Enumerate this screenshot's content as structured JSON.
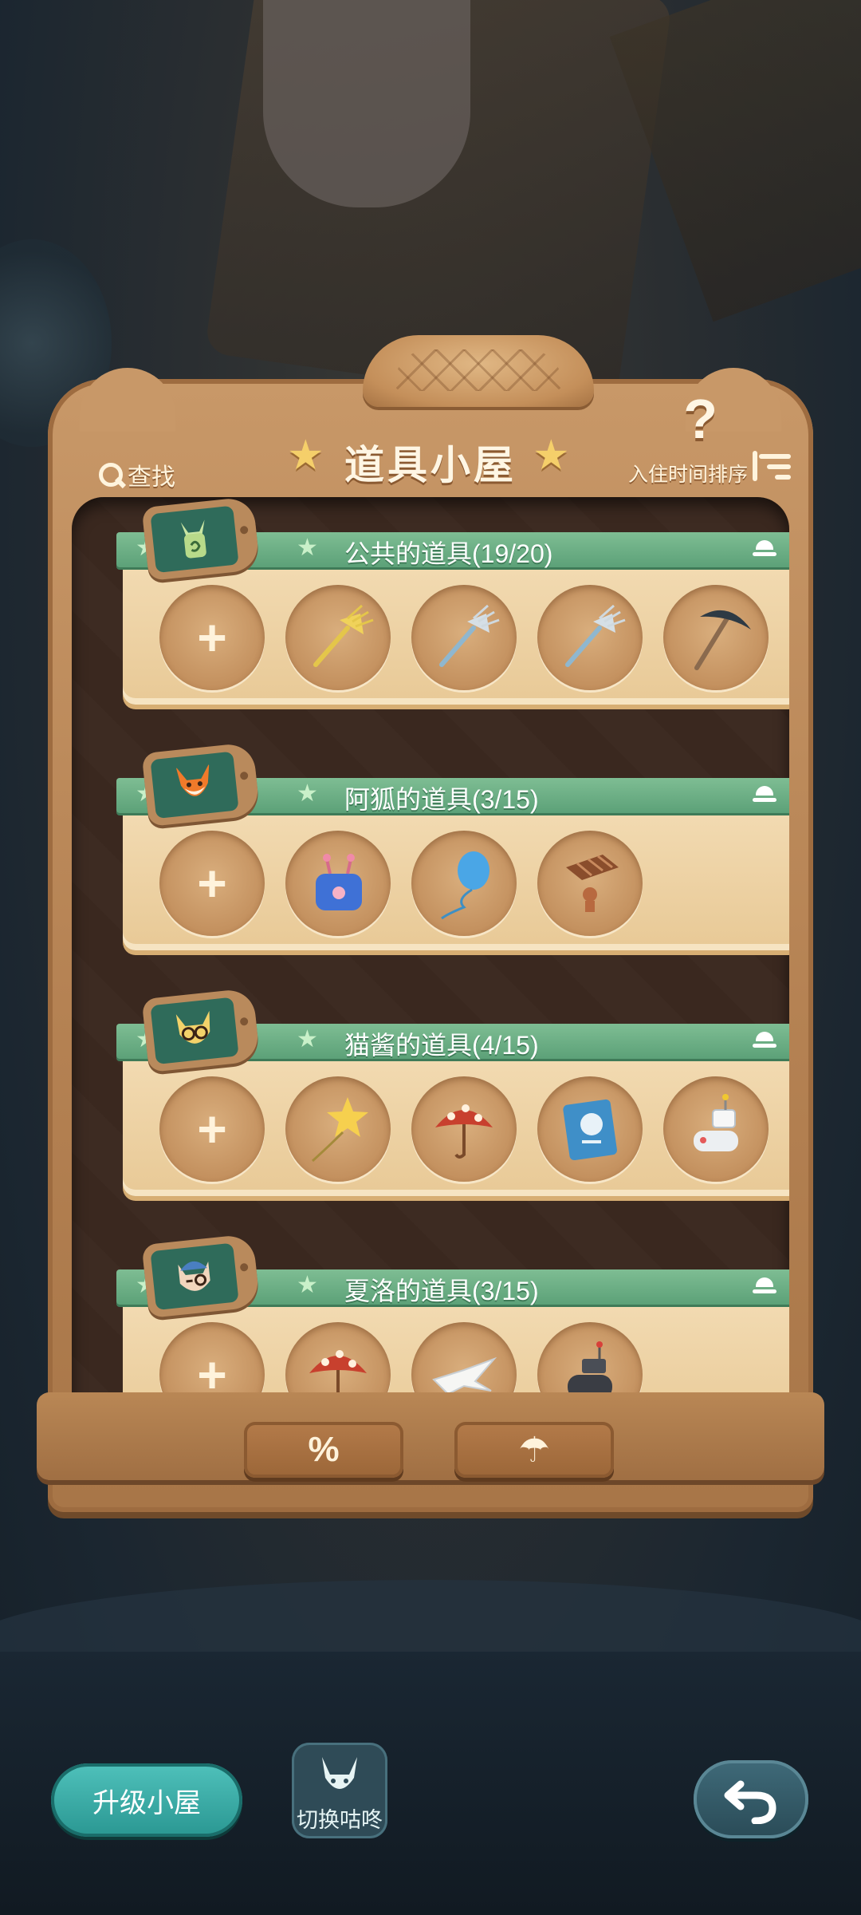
{
  "header": {
    "title": "道具小屋",
    "search_label": "查找",
    "sort_label": "入住时间排序",
    "help_label": "?"
  },
  "sections": [
    {
      "title": "公共的道具(19/20)",
      "avatar": "green-rabbit-icon",
      "items": [
        "add-slot",
        "yellow-rake-icon",
        "blue-rake-icon",
        "blue-rake-icon",
        "pickaxe-icon"
      ]
    },
    {
      "title": "阿狐的道具(3/15)",
      "avatar": "fox-icon",
      "items": [
        "add-slot",
        "blue-bag-icon",
        "balloon-icon",
        "chocolate-toy-icon"
      ]
    },
    {
      "title": "猫酱的道具(4/15)",
      "avatar": "cat-glasses-icon",
      "items": [
        "add-slot",
        "star-balloon-icon",
        "mushroom-umbrella-icon",
        "book-icon",
        "robot-toy-icon"
      ]
    },
    {
      "title": "夏洛的道具(3/15)",
      "avatar": "cat-cap-icon",
      "items": [
        "add-slot",
        "mushroom-umbrella-icon",
        "paper-crane-icon",
        "game-controller-icon"
      ]
    }
  ],
  "base_buttons": [
    {
      "icon": "percent-icon",
      "label": "%"
    },
    {
      "icon": "umbrella-icon",
      "label": "☂"
    }
  ],
  "footer": {
    "upgrade_label": "升级小屋",
    "switch_label": "切换咕咚",
    "back_icon": "back-arrow-icon"
  },
  "colors": {
    "shelf_bar": "#5ca178",
    "wood": "#b58253",
    "shelf": "#f3dcb4",
    "teal_button": "#2a9792"
  }
}
